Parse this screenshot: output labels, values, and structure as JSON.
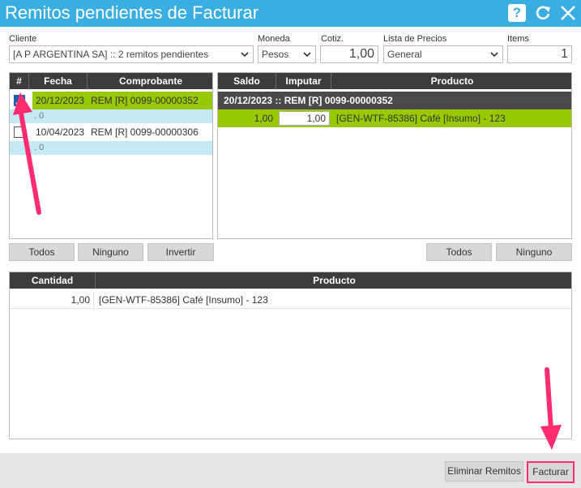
{
  "window": {
    "title": "Remitos pendientes de Facturar"
  },
  "header": {
    "cliente_label": "Cliente",
    "cliente_value": "[A P ARGENTINA SA] :: 2 remitos pendientes",
    "moneda_label": "Moneda",
    "moneda_value": "Pesos",
    "cotiz_label": "Cotiz.",
    "cotiz_value": "1,00",
    "lista_label": "Lista de Precios",
    "lista_value": "General",
    "items_label": "Items",
    "items_value": "1"
  },
  "remitos": {
    "columns": [
      "#",
      "Fecha",
      "Comprobante"
    ],
    "rows": [
      {
        "checked": true,
        "fecha": "20/12/2023",
        "comprobante": "REM [R] 0099-00000352",
        "sub": ". 0"
      },
      {
        "checked": false,
        "fecha": "10/04/2023",
        "comprobante": "REM [R] 0099-00000306",
        "sub": ". 0"
      }
    ],
    "buttons": {
      "todos": "Todos",
      "ninguno": "Ninguno",
      "invertir": "Invertir"
    }
  },
  "items": {
    "columns": [
      "Saldo",
      "Imputar",
      "Producto"
    ],
    "group_header": "20/12/2023 :: REM [R] 0099-00000352",
    "rows": [
      {
        "saldo": "1,00",
        "imputar": "1,00",
        "producto": "[GEN-WTF-85386] Café [Insumo] - 123"
      }
    ],
    "buttons": {
      "todos": "Todos",
      "ninguno": "Ninguno"
    }
  },
  "summary": {
    "columns": [
      "Cantidad",
      "Producto"
    ],
    "rows": [
      {
        "cantidad": "1,00",
        "producto": "[GEN-WTF-85386] Café [Insumo] - 123"
      }
    ]
  },
  "footer": {
    "eliminar": "Eliminar Remitos",
    "facturar": "Facturar"
  },
  "colors": {
    "titlebar": "#3aaee0",
    "selected_row": "#97c800",
    "highlight": "#ff2d6f"
  }
}
